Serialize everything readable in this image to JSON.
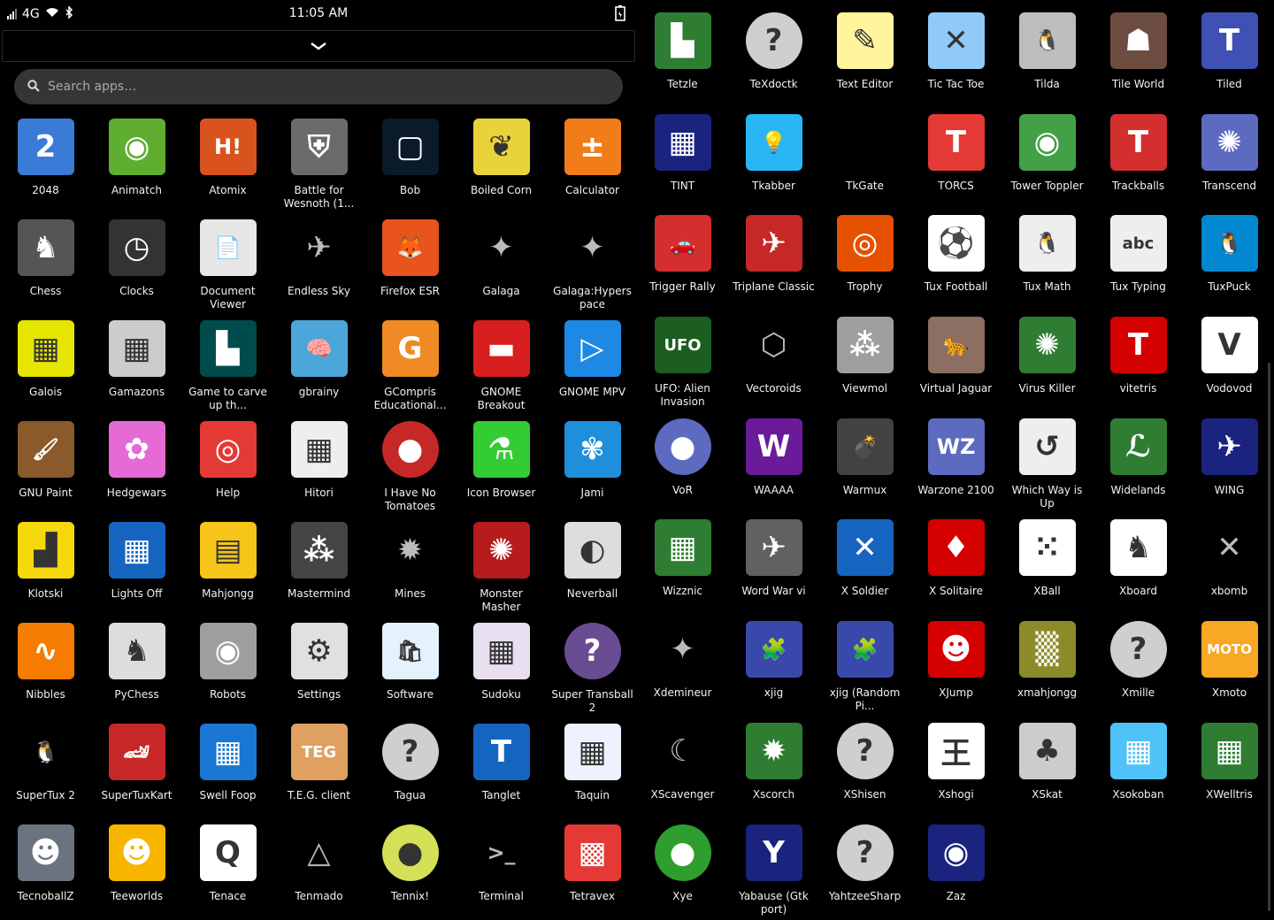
{
  "status_bar": {
    "network": "4G",
    "time": "11:05 AM"
  },
  "search": {
    "placeholder": "Search apps…"
  },
  "apps_left": [
    {
      "label": "2048",
      "icon": "2048-icon",
      "color": "#3a7bd5",
      "glyph": "2"
    },
    {
      "label": "Animatch",
      "icon": "animatch-icon",
      "color": "#5fae2f",
      "glyph": "◉"
    },
    {
      "label": "Atomix",
      "icon": "atomix-icon",
      "color": "#d9531e",
      "glyph": "H!"
    },
    {
      "label": "Battle for Wesnoth (1...",
      "icon": "wesnoth-icon",
      "color": "#6b6b6b",
      "glyph": "⛨"
    },
    {
      "label": "Bob",
      "icon": "bob-icon",
      "color": "#0b1a2a",
      "glyph": "▢"
    },
    {
      "label": "Boiled Corn",
      "icon": "boiled-corn-icon",
      "color": "#e8d33a",
      "glyph": "❦"
    },
    {
      "label": "Calculator",
      "icon": "calculator-icon",
      "color": "#f07c1a",
      "glyph": "±"
    },
    {
      "label": "Chess",
      "icon": "chess-icon",
      "color": "#555555",
      "glyph": "♞"
    },
    {
      "label": "Clocks",
      "icon": "clock-icon",
      "color": "#333333",
      "glyph": "◷"
    },
    {
      "label": "Document Viewer",
      "icon": "document-viewer-icon",
      "color": "#e6e6e6",
      "glyph": "📄"
    },
    {
      "label": "Endless Sky",
      "icon": "endless-sky-icon",
      "color": "#1e1e1e",
      "glyph": "✈"
    },
    {
      "label": "Firefox ESR",
      "icon": "firefox-icon",
      "color": "#e8541b",
      "glyph": "🦊"
    },
    {
      "label": "Galaga",
      "icon": "galaga-icon",
      "color": "#000000",
      "glyph": "✦"
    },
    {
      "label": "Galaga:Hyperspace",
      "icon": "galaga-hyperspace-icon",
      "color": "#000000",
      "glyph": "✦"
    },
    {
      "label": "Galois",
      "icon": "galois-icon",
      "color": "#e5e500",
      "glyph": "▦"
    },
    {
      "label": "Gamazons",
      "icon": "gamazons-icon",
      "color": "#cccccc",
      "glyph": "▦"
    },
    {
      "label": "Game to carve up th...",
      "icon": "game-carve-icon",
      "color": "#004c4c",
      "glyph": "▙"
    },
    {
      "label": "gbrainy",
      "icon": "gbrainy-icon",
      "color": "#4da6d9",
      "glyph": "🧠"
    },
    {
      "label": "GCompris Educational...",
      "icon": "gcompris-icon",
      "color": "#f08a24",
      "glyph": "G"
    },
    {
      "label": "GNOME Breakout",
      "icon": "gnome-breakout-icon",
      "color": "#d81e1e",
      "glyph": "▬"
    },
    {
      "label": "GNOME MPV",
      "icon": "gnome-mpv-icon",
      "color": "#1e88e5",
      "glyph": "▷"
    },
    {
      "label": "GNU Paint",
      "icon": "gnu-paint-icon",
      "color": "#8a5a2b",
      "glyph": "🖌"
    },
    {
      "label": "Hedgewars",
      "icon": "hedgewars-icon",
      "color": "#e56ad6",
      "glyph": "✿"
    },
    {
      "label": "Help",
      "icon": "help-icon",
      "color": "#e53935",
      "glyph": "◎"
    },
    {
      "label": "Hitori",
      "icon": "hitori-icon",
      "color": "#eeeeee",
      "glyph": "▦"
    },
    {
      "label": "I Have No Tomatoes",
      "icon": "tomatoes-icon",
      "color": "#c62828",
      "glyph": "●"
    },
    {
      "label": "Icon Browser",
      "icon": "icon-browser-icon",
      "color": "#33cc33",
      "glyph": "⚗"
    },
    {
      "label": "Jami",
      "icon": "jami-icon",
      "color": "#1f8fdb",
      "glyph": "✾"
    },
    {
      "label": "Klotski",
      "icon": "klotski-icon",
      "color": "#f5d90a",
      "glyph": "▟"
    },
    {
      "label": "Lights Off",
      "icon": "lights-off-icon",
      "color": "#1565c0",
      "glyph": "▦"
    },
    {
      "label": "Mahjongg",
      "icon": "mahjongg-icon",
      "color": "#f5c518",
      "glyph": "▤"
    },
    {
      "label": "Mastermind",
      "icon": "mastermind-icon",
      "color": "#444444",
      "glyph": "⁂"
    },
    {
      "label": "Mines",
      "icon": "mines-icon",
      "color": "#222222",
      "glyph": "✹"
    },
    {
      "label": "Monster Masher",
      "icon": "monster-masher-icon",
      "color": "#b71c1c",
      "glyph": "✺"
    },
    {
      "label": "Neverball",
      "icon": "neverball-icon",
      "color": "#dddddd",
      "glyph": "◐"
    },
    {
      "label": "Nibbles",
      "icon": "nibbles-icon",
      "color": "#f57c00",
      "glyph": "∿"
    },
    {
      "label": "PyChess",
      "icon": "pychess-icon",
      "color": "#dddddd",
      "glyph": "♞"
    },
    {
      "label": "Robots",
      "icon": "robots-icon",
      "color": "#9e9e9e",
      "glyph": "◉"
    },
    {
      "label": "Settings",
      "icon": "settings-icon",
      "color": "#e0e0e0",
      "glyph": "⚙"
    },
    {
      "label": "Software",
      "icon": "software-icon",
      "color": "#e3f2fd",
      "glyph": "🛍"
    },
    {
      "label": "Sudoku",
      "icon": "sudoku-icon",
      "color": "#e8e0f0",
      "glyph": "▦"
    },
    {
      "label": "Super Transball 2",
      "icon": "transball-icon",
      "color": "#6a4c93",
      "glyph": "?"
    },
    {
      "label": "SuperTux 2",
      "icon": "supertux-icon",
      "color": "#1e1e1e",
      "glyph": "🐧"
    },
    {
      "label": "SuperTuxKart",
      "icon": "supertuxkart-icon",
      "color": "#c62828",
      "glyph": "🏎"
    },
    {
      "label": "Swell Foop",
      "icon": "swell-foop-icon",
      "color": "#1976d2",
      "glyph": "▦"
    },
    {
      "label": "T.E.G. client",
      "icon": "teg-icon",
      "color": "#e0a060",
      "glyph": "TEG"
    },
    {
      "label": "Tagua",
      "icon": "tagua-icon",
      "color": "#cfcfcf",
      "glyph": "?"
    },
    {
      "label": "Tanglet",
      "icon": "tanglet-icon",
      "color": "#1565c0",
      "glyph": "T"
    },
    {
      "label": "Taquin",
      "icon": "taquin-icon",
      "color": "#eef2ff",
      "glyph": "▦"
    },
    {
      "label": "TecnoballZ",
      "icon": "tecnoballz-icon",
      "color": "#6b7280",
      "glyph": "☻"
    },
    {
      "label": "Teeworlds",
      "icon": "teeworlds-icon",
      "color": "#f7b500",
      "glyph": "☻"
    },
    {
      "label": "Tenace",
      "icon": "tenace-icon",
      "color": "#ffffff",
      "glyph": "Q"
    },
    {
      "label": "Tenmado",
      "icon": "tenmado-icon",
      "color": "#000000",
      "glyph": "△"
    },
    {
      "label": "Tennix!",
      "icon": "tennix-icon",
      "color": "#d4e157",
      "glyph": "●"
    },
    {
      "label": "Terminal",
      "icon": "terminal-icon",
      "color": "#2b2b2b",
      "glyph": ">_"
    },
    {
      "label": "Tetravex",
      "icon": "tetravex-icon",
      "color": "#e53935",
      "glyph": "▩"
    }
  ],
  "apps_right": [
    {
      "label": "Tetzle",
      "icon": "tetzle-icon",
      "color": "#2e7d32",
      "glyph": "▙"
    },
    {
      "label": "TeXdoctk",
      "icon": "texdoctk-icon",
      "color": "#cfcfcf",
      "glyph": "?"
    },
    {
      "label": "Text Editor",
      "icon": "text-editor-icon",
      "color": "#fff59d",
      "glyph": "✎"
    },
    {
      "label": "Tic Tac Toe",
      "icon": "tic-tac-toe-icon",
      "color": "#90caf9",
      "glyph": "✕"
    },
    {
      "label": "Tilda",
      "icon": "tilda-icon",
      "color": "#bdbdbd",
      "glyph": "🐧"
    },
    {
      "label": "Tile World",
      "icon": "tile-world-icon",
      "color": "#6d4c41",
      "glyph": "☗"
    },
    {
      "label": "Tiled",
      "icon": "tiled-icon",
      "color": "#3f51b5",
      "glyph": "T"
    },
    {
      "label": "TINT",
      "icon": "tint-icon",
      "color": "#1a237e",
      "glyph": "▦"
    },
    {
      "label": "Tkabber",
      "icon": "tkabber-icon",
      "color": "#29b6f6",
      "glyph": "💡"
    },
    {
      "label": "TkGate",
      "icon": "tkgate-icon",
      "color": "#000000",
      "glyph": ""
    },
    {
      "label": "TORCS",
      "icon": "torcs-icon",
      "color": "#e53935",
      "glyph": "T"
    },
    {
      "label": "Tower Toppler",
      "icon": "tower-toppler-icon",
      "color": "#43a047",
      "glyph": "◉"
    },
    {
      "label": "Trackballs",
      "icon": "trackballs-icon",
      "color": "#d32f2f",
      "glyph": "T"
    },
    {
      "label": "Transcend",
      "icon": "transcend-icon",
      "color": "#5c6bc0",
      "glyph": "✺"
    },
    {
      "label": "Trigger Rally",
      "icon": "trigger-rally-icon",
      "color": "#d32f2f",
      "glyph": "🚗"
    },
    {
      "label": "Triplane Classic",
      "icon": "triplane-icon",
      "color": "#c62828",
      "glyph": "✈"
    },
    {
      "label": "Trophy",
      "icon": "trophy-icon",
      "color": "#e65100",
      "glyph": "◎"
    },
    {
      "label": "Tux Football",
      "icon": "tux-football-icon",
      "color": "#ffffff",
      "glyph": "⚽"
    },
    {
      "label": "Tux Math",
      "icon": "tux-math-icon",
      "color": "#eeeeee",
      "glyph": "🐧"
    },
    {
      "label": "Tux Typing",
      "icon": "tux-typing-icon",
      "color": "#eeeeee",
      "glyph": "abc"
    },
    {
      "label": "TuxPuck",
      "icon": "tuxpuck-icon",
      "color": "#0288d1",
      "glyph": "🐧"
    },
    {
      "label": "UFO: Alien Invasion",
      "icon": "ufo-icon",
      "color": "#1b5e20",
      "glyph": "UFO"
    },
    {
      "label": "Vectoroids",
      "icon": "vectoroids-icon",
      "color": "#000000",
      "glyph": "⬡"
    },
    {
      "label": "Viewmol",
      "icon": "viewmol-icon",
      "color": "#9e9e9e",
      "glyph": "⁂"
    },
    {
      "label": "Virtual Jaguar",
      "icon": "virtual-jaguar-icon",
      "color": "#8d6e63",
      "glyph": "🐆"
    },
    {
      "label": "Virus Killer",
      "icon": "virus-killer-icon",
      "color": "#2e7d32",
      "glyph": "✺"
    },
    {
      "label": "vitetris",
      "icon": "vitetris-icon",
      "color": "#d50000",
      "glyph": "T"
    },
    {
      "label": "Vodovod",
      "icon": "vodovod-icon",
      "color": "#ffffff",
      "glyph": "V"
    },
    {
      "label": "VoR",
      "icon": "vor-icon",
      "color": "#5c6bc0",
      "glyph": "●"
    },
    {
      "label": "WAAAA",
      "icon": "waaaa-icon",
      "color": "#6a1b9a",
      "glyph": "W"
    },
    {
      "label": "Warmux",
      "icon": "warmux-icon",
      "color": "#424242",
      "glyph": "💣"
    },
    {
      "label": "Warzone 2100",
      "icon": "warzone-icon",
      "color": "#5c6bc0",
      "glyph": "WZ"
    },
    {
      "label": "Which Way is Up",
      "icon": "which-way-icon",
      "color": "#eeeeee",
      "glyph": "↺"
    },
    {
      "label": "Widelands",
      "icon": "widelands-icon",
      "color": "#2e7d32",
      "glyph": "ℒ"
    },
    {
      "label": "WING",
      "icon": "wing-icon",
      "color": "#1a237e",
      "glyph": "✈"
    },
    {
      "label": "Wizznic",
      "icon": "wizznic-icon",
      "color": "#2e7d32",
      "glyph": "▦"
    },
    {
      "label": "Word War vi",
      "icon": "word-war-icon",
      "color": "#616161",
      "glyph": "✈"
    },
    {
      "label": "X Soldier",
      "icon": "x-soldier-icon",
      "color": "#1565c0",
      "glyph": "✕"
    },
    {
      "label": "X Solitaire",
      "icon": "x-solitaire-icon",
      "color": "#d50000",
      "glyph": "♦"
    },
    {
      "label": "XBall",
      "icon": "xball-icon",
      "color": "#ffffff",
      "glyph": "⁙"
    },
    {
      "label": "Xboard",
      "icon": "xboard-icon",
      "color": "#ffffff",
      "glyph": "♞"
    },
    {
      "label": "xbomb",
      "icon": "xbomb-icon",
      "color": "#111111",
      "glyph": "✕"
    },
    {
      "label": "Xdemineur",
      "icon": "xdemineur-icon",
      "color": "#000000",
      "glyph": "✦"
    },
    {
      "label": "xjig",
      "icon": "xjig-icon",
      "color": "#3949ab",
      "glyph": "🧩"
    },
    {
      "label": "xjig (Random Pi...",
      "icon": "xjig-random-icon",
      "color": "#3949ab",
      "glyph": "🧩"
    },
    {
      "label": "XJump",
      "icon": "xjump-icon",
      "color": "#d50000",
      "glyph": "☻"
    },
    {
      "label": "xmahjongg",
      "icon": "xmahjongg-icon",
      "color": "#8d8a2a",
      "glyph": "▒"
    },
    {
      "label": "Xmille",
      "icon": "xmille-icon",
      "color": "#cfcfcf",
      "glyph": "?"
    },
    {
      "label": "Xmoto",
      "icon": "xmoto-icon",
      "color": "#f9a825",
      "glyph": "MOTO"
    },
    {
      "label": "XScavenger",
      "icon": "xscavenger-icon",
      "color": "#000000",
      "glyph": "☾"
    },
    {
      "label": "Xscorch",
      "icon": "xscorch-icon",
      "color": "#2e7d32",
      "glyph": "✹"
    },
    {
      "label": "XShisen",
      "icon": "xshisen-icon",
      "color": "#cfcfcf",
      "glyph": "?"
    },
    {
      "label": "Xshogi",
      "icon": "xshogi-icon",
      "color": "#ffffff",
      "glyph": "王"
    },
    {
      "label": "XSkat",
      "icon": "xskat-icon",
      "color": "#cccccc",
      "glyph": "♣"
    },
    {
      "label": "Xsokoban",
      "icon": "xsokoban-icon",
      "color": "#4fc3f7",
      "glyph": "▦"
    },
    {
      "label": "XWelltris",
      "icon": "xwelltris-icon",
      "color": "#2e7d32",
      "glyph": "▦"
    },
    {
      "label": "Xye",
      "icon": "xye-icon",
      "color": "#2e9e2e",
      "glyph": "●"
    },
    {
      "label": "Yabause (Gtk port)",
      "icon": "yabause-icon",
      "color": "#1a237e",
      "glyph": "Y"
    },
    {
      "label": "YahtzeeSharp",
      "icon": "yahtzeesharp-icon",
      "color": "#cfcfcf",
      "glyph": "?"
    },
    {
      "label": "Zaz",
      "icon": "zaz-icon",
      "color": "#1a237e",
      "glyph": "◉"
    }
  ]
}
